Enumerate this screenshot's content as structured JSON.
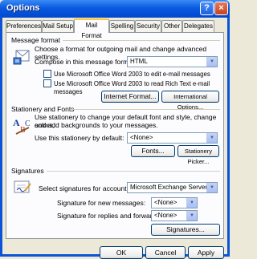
{
  "window": {
    "title": "Options",
    "help_label": "?",
    "close_label": "×"
  },
  "tabs": [
    {
      "label": "Preferences"
    },
    {
      "label": "Mail Setup"
    },
    {
      "label": "Mail Format"
    },
    {
      "label": "Spelling"
    },
    {
      "label": "Security"
    },
    {
      "label": "Other"
    },
    {
      "label": "Delegates"
    }
  ],
  "message_format": {
    "heading": "Message format",
    "description": "Choose a format for outgoing mail and change advanced settings.",
    "compose_label": "Compose in this message format:",
    "compose_value": "HTML",
    "check_edit": "Use Microsoft Office Word 2003 to edit e-mail messages",
    "check_read": "Use Microsoft Office Word 2003 to read Rich Text e-mail messages",
    "internet_button": "Internet Format...",
    "international_button": "International Options..."
  },
  "stationery": {
    "heading": "Stationery and Fonts",
    "description_line1": "Use stationery to change your default font and style, change colors,",
    "description_line2": "and add backgrounds to your messages.",
    "use_label": "Use this stationery by default:",
    "use_value": "<None>",
    "fonts_button": "Fonts...",
    "picker_button": "Stationery Picker..."
  },
  "signatures": {
    "heading": "Signatures",
    "account_label": "Select signatures for account:",
    "account_value": "Microsoft Exchange Server",
    "new_label": "Signature for new messages:",
    "new_value": "<None>",
    "reply_label": "Signature for replies and forwards:",
    "reply_value": "<None>",
    "signatures_button": "Signatures..."
  },
  "footer": {
    "ok": "OK",
    "cancel": "Cancel",
    "apply": "Apply"
  }
}
